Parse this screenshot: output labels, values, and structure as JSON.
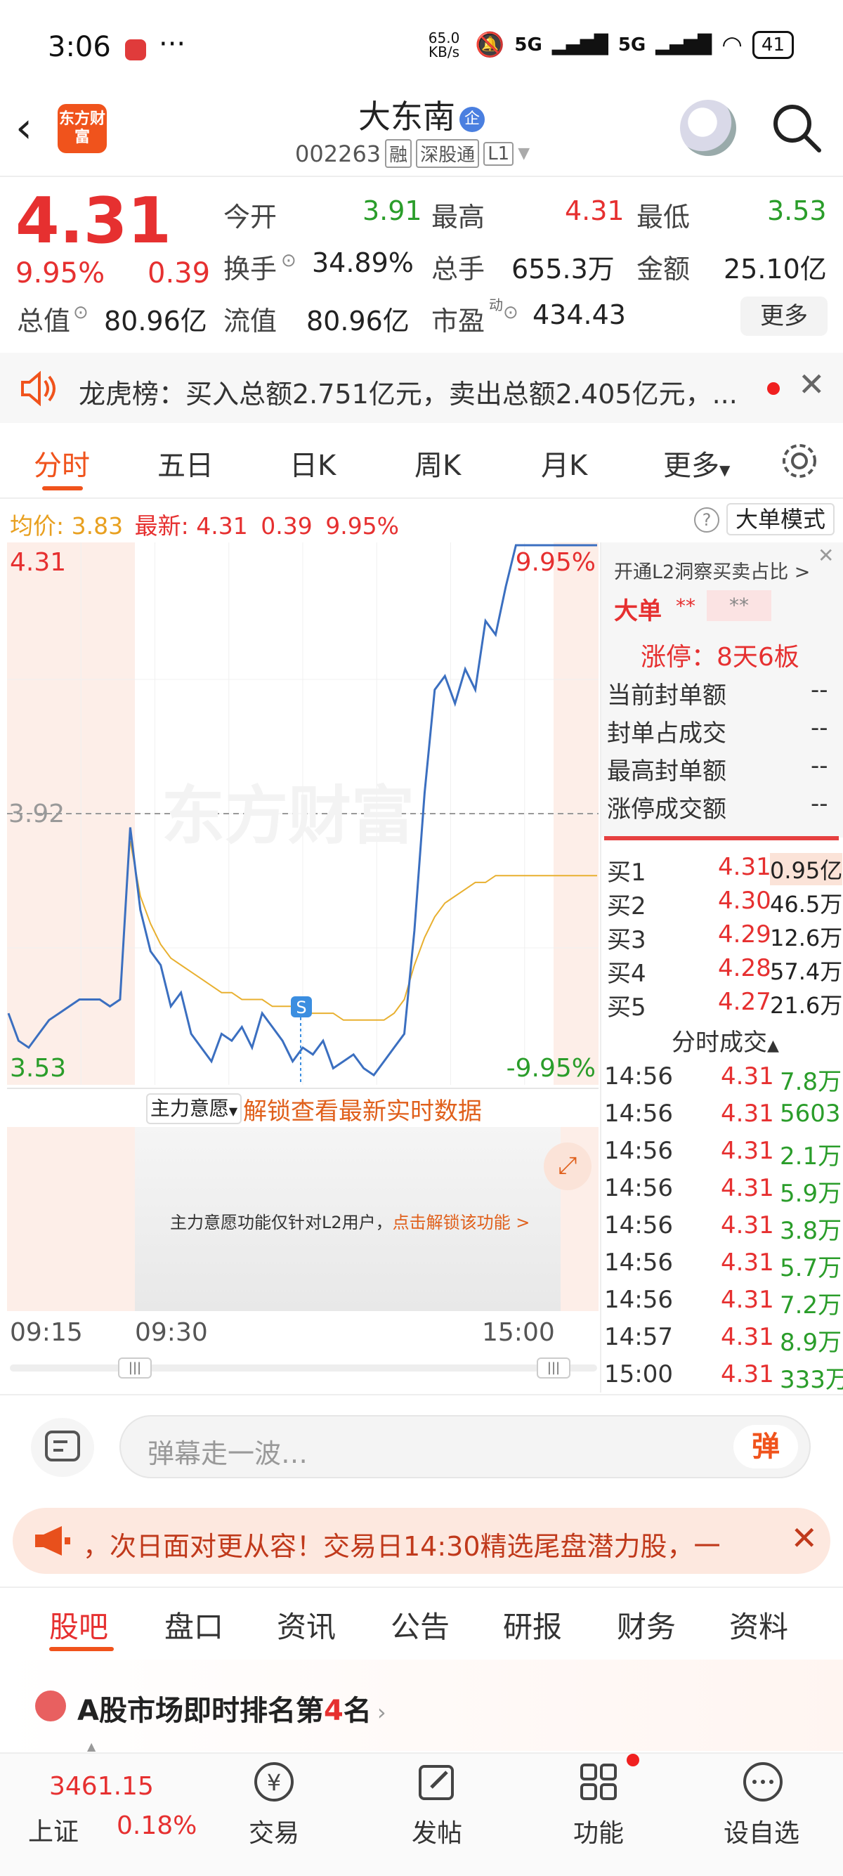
{
  "status_bar": {
    "time": "3:06",
    "dots": "···",
    "net_speed": "65.0 KB/s",
    "signal": "5G",
    "battery": "41"
  },
  "header": {
    "logo": "东方财富",
    "name": "大东南",
    "badge": "企",
    "code": "002263",
    "tags": [
      "融",
      "深股通",
      "L1"
    ]
  },
  "quote": {
    "price": "4.31",
    "change_pct": "9.95%",
    "change": "0.39",
    "open_label": "今开",
    "open": "3.91",
    "high_label": "最高",
    "high": "4.31",
    "low_label": "最低",
    "low": "3.53",
    "turnover_label": "换手",
    "turnover": "34.89%",
    "volume_label": "总手",
    "volume": "655.3万",
    "amount_label": "金额",
    "amount": "25.10亿",
    "mktcap_label": "总值",
    "mktcap": "80.96亿",
    "float_label": "流值",
    "float": "80.96亿",
    "pe_label": "市盈",
    "pe_sup": "动",
    "pe": "434.43",
    "more": "更多"
  },
  "dragon_tiger": {
    "text": "龙虎榜：买入总额2.751亿元，卖出总额2.405亿元，..."
  },
  "chart_tabs": [
    "分时",
    "五日",
    "日K",
    "周K",
    "月K",
    "更多"
  ],
  "chart_info": {
    "avg_label": "均价:",
    "avg": "3.83",
    "latest_label": "最新:",
    "latest": "4.31",
    "chg": "0.39",
    "pct": "9.95%",
    "help": "?",
    "big_order_mode": "大单模式"
  },
  "chart_labels": {
    "top_price": "4.31",
    "top_pct": "9.95%",
    "mid_price": "3.92",
    "bottom_price": "3.53",
    "bottom_pct": "-9.95%",
    "watermark": "东方财富",
    "signal_mark": "S",
    "time_start": "09:15",
    "time_open": "09:30",
    "time_end": "15:00"
  },
  "chart_data": {
    "type": "line",
    "ylim": [
      3.53,
      4.31
    ],
    "reference": 3.92,
    "series": [
      {
        "values": [
          3.63,
          3.59,
          3.58,
          3.6,
          3.62,
          3.63,
          3.64,
          3.65,
          3.65,
          3.65,
          3.64,
          3.65,
          3.9,
          3.78,
          3.72,
          3.7,
          3.64,
          3.66,
          3.6,
          3.58,
          3.56,
          3.6,
          3.59,
          3.61,
          3.58,
          3.63,
          3.61,
          3.59,
          3.56,
          3.58,
          3.57,
          3.59,
          3.55,
          3.56,
          3.57,
          3.55,
          3.54,
          3.56,
          3.58,
          3.6,
          3.75,
          3.95,
          4.1,
          4.12,
          4.08,
          4.13,
          4.1,
          4.2,
          4.18,
          4.25,
          4.31,
          4.31,
          4.31,
          4.31,
          4.31,
          4.31,
          4.31,
          4.31,
          4.31
        ]
      },
      {
        "values": [
          null,
          null,
          null,
          null,
          null,
          null,
          null,
          null,
          null,
          null,
          null,
          null,
          3.88,
          3.8,
          3.76,
          3.73,
          3.71,
          3.7,
          3.69,
          3.68,
          3.67,
          3.66,
          3.66,
          3.65,
          3.65,
          3.65,
          3.64,
          3.64,
          3.64,
          3.63,
          3.63,
          3.63,
          3.63,
          3.62,
          3.62,
          3.62,
          3.62,
          3.62,
          3.63,
          3.65,
          3.7,
          3.74,
          3.77,
          3.79,
          3.8,
          3.81,
          3.82,
          3.82,
          3.83,
          3.83,
          3.83,
          3.83,
          3.83,
          3.83,
          3.83,
          3.83,
          3.83,
          3.83,
          3.83
        ]
      }
    ]
  },
  "sub_chart": {
    "selector": "主力意愿",
    "unlock_text": "解锁查看最新实时数据",
    "mask_text": "主力意愿功能仅针对L2用户，",
    "mask_link": "点击解锁该功能 >"
  },
  "right_panel": {
    "l2_title": "开通L2洞察买卖占比 >",
    "big_label": "大单",
    "big_val1": "**",
    "big_val2": "**",
    "limit_up": "涨停：8天6板",
    "rows": [
      {
        "label": "当前封单额",
        "value": "--"
      },
      {
        "label": "封单占成交",
        "value": "--"
      },
      {
        "label": "最高封单额",
        "value": "--"
      },
      {
        "label": "涨停成交额",
        "value": "--"
      }
    ],
    "bids": [
      {
        "label": "买1",
        "price": "4.31",
        "vol": "0.95亿"
      },
      {
        "label": "买2",
        "price": "4.30",
        "vol": "46.5万"
      },
      {
        "label": "买3",
        "price": "4.29",
        "vol": "12.6万"
      },
      {
        "label": "买4",
        "price": "4.28",
        "vol": "57.4万"
      },
      {
        "label": "买5",
        "price": "4.27",
        "vol": "21.6万"
      }
    ],
    "trades_title": "分时成交",
    "trades": [
      {
        "time": "14:56",
        "price": "4.31",
        "vol": "7.8万"
      },
      {
        "time": "14:56",
        "price": "4.31",
        "vol": "5603"
      },
      {
        "time": "14:56",
        "price": "4.31",
        "vol": "2.1万"
      },
      {
        "time": "14:56",
        "price": "4.31",
        "vol": "5.9万"
      },
      {
        "time": "14:56",
        "price": "4.31",
        "vol": "3.8万"
      },
      {
        "time": "14:56",
        "price": "4.31",
        "vol": "5.7万"
      },
      {
        "time": "14:56",
        "price": "4.31",
        "vol": "7.2万"
      },
      {
        "time": "14:57",
        "price": "4.31",
        "vol": "8.9万"
      },
      {
        "time": "15:00",
        "price": "4.31",
        "vol": "333万"
      }
    ]
  },
  "comment": {
    "placeholder": "弹幕走一波…",
    "dan": "弹"
  },
  "banner": {
    "text": "，次日面对更从容！交易日14:30精选尾盘潜力股，一"
  },
  "lower_tabs": [
    "股吧",
    "盘口",
    "资讯",
    "公告",
    "研报",
    "财务",
    "资料"
  ],
  "rank": {
    "text_a": "A股市场即时排名第",
    "num": "4",
    "text_b": "名"
  },
  "bottom_nav": {
    "index_value": "3461.15",
    "index_name": "上证",
    "index_pct": "0.18%",
    "items": [
      "交易",
      "发帖",
      "功能",
      "设自选"
    ]
  },
  "colors": {
    "up": "#e63030",
    "down": "#2a9d2a",
    "brand": "#f0531c",
    "line": "#3b6fc0",
    "avg": "#e8b030"
  }
}
